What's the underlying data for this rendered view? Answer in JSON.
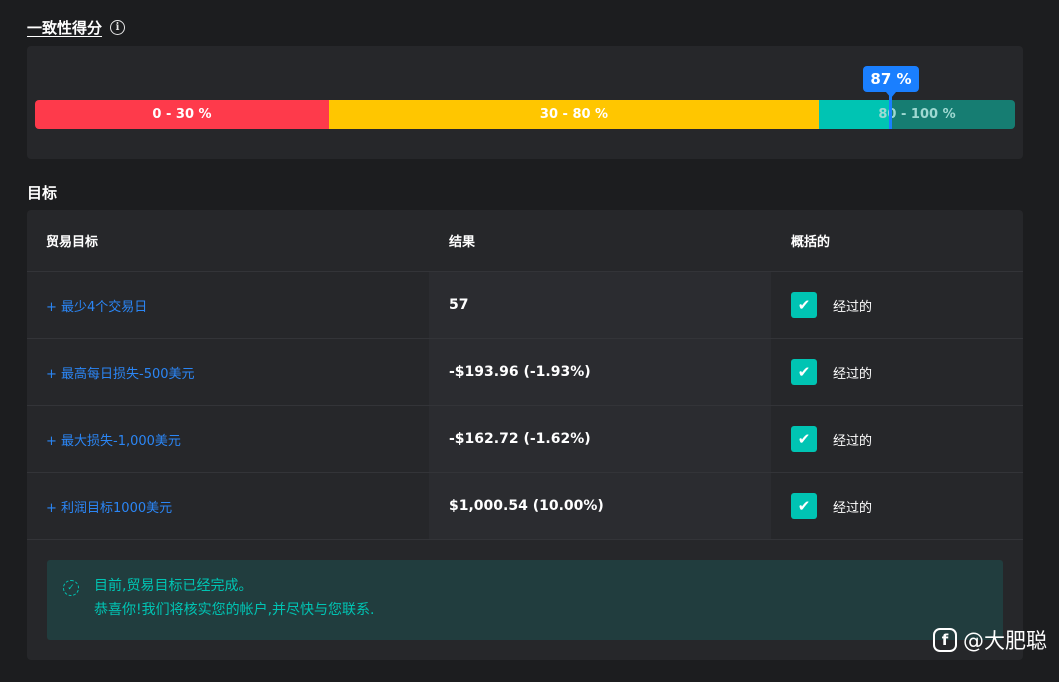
{
  "score_section": {
    "title": "一致性得分",
    "info_icon": "info-icon",
    "segments": [
      {
        "label": "0 - 30 %",
        "color": "#fe3a4b"
      },
      {
        "label": "30 - 80 %",
        "color": "#ffc600"
      },
      {
        "label": "80 - 100 %",
        "color": "#00c4b3"
      }
    ],
    "marker_label": "87 %",
    "marker_value": 87,
    "marker_color": "#1a7fff"
  },
  "goals_section": {
    "title": "目标",
    "columns": [
      "贸易目标",
      "结果",
      "概括的"
    ],
    "rows": [
      {
        "goal": "+ 最少4个交易日",
        "result": "57",
        "status": "经过的",
        "status_icon": "check-icon"
      },
      {
        "goal": "+ 最高每日损失-500美元",
        "result": "-$193.96 (-1.93%)",
        "status": "经过的",
        "status_icon": "check-icon"
      },
      {
        "goal": "+ 最大损失-1,000美元",
        "result": "-$162.72 (-1.62%)",
        "status": "经过的",
        "status_icon": "check-icon"
      },
      {
        "goal": "+ 利润目标1000美元",
        "result": "$1,000.54 (10.00%)",
        "status": "经过的",
        "status_icon": "check-icon"
      }
    ],
    "notice": {
      "line1": "目前,贸易目标已经完成。",
      "line2": "恭喜你!我们将核实您的帐户,并尽快与您联系.",
      "icon": "badge-check-icon",
      "color": "#00c4b3"
    }
  },
  "watermark": "@大肥聪"
}
